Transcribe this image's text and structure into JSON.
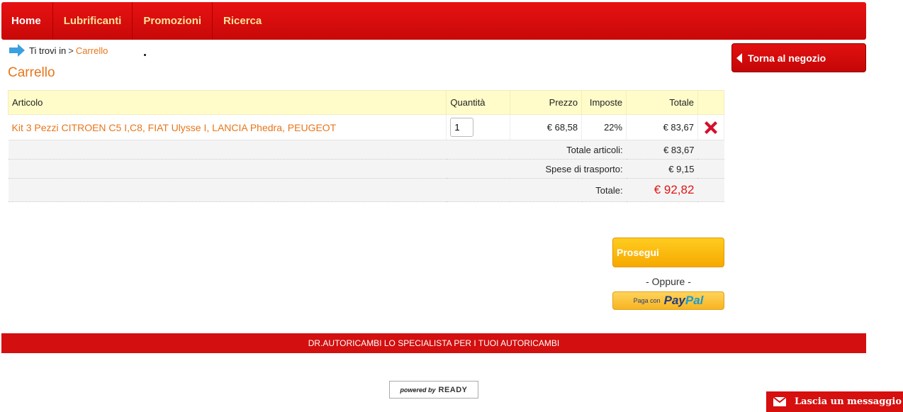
{
  "nav": {
    "items": [
      {
        "label": "Home"
      },
      {
        "label": "Lubrificanti"
      },
      {
        "label": "Promozioni"
      },
      {
        "label": "Ricerca"
      }
    ]
  },
  "breadcrumb": {
    "prefix": "Ti trovi in",
    "separator": ">",
    "current": "Carrello"
  },
  "page_title": "Carrello",
  "back_button": {
    "label": "Torna al negozio"
  },
  "cart": {
    "headers": {
      "articolo": "Articolo",
      "quantita": "Quantità",
      "prezzo": "Prezzo",
      "imposte": "Imposte",
      "totale": "Totale"
    },
    "items": [
      {
        "name": "Kit 3 Pezzi CITROEN C5 I,C8, FIAT Ulysse I, LANCIA Phedra, PEUGEOT",
        "quantity": "1",
        "price": "€ 68,58",
        "tax": "22%",
        "total": "€ 83,67"
      }
    ],
    "summary": {
      "items_label": "Totale articoli:",
      "items_value": "€ 83,67",
      "shipping_label": "Spese di trasporto:",
      "shipping_value": "€ 9,15",
      "grand_label": "Totale:",
      "grand_value": "€ 92,82"
    }
  },
  "actions": {
    "proceed_label": "Prosegui",
    "or_text": "- Oppure -",
    "paypal_prefix": "Paga con",
    "paypal_brand_a": "Pay",
    "paypal_brand_b": "Pal"
  },
  "footer": {
    "text": "DR.AUTORICAMBI LO SPECIALISTA PER I TUOI AUTORICAMBI",
    "powered_prefix": "powered by",
    "powered_brand": "READY"
  },
  "message_widget": {
    "label": "Lascia un messaggio"
  },
  "colors": {
    "brand_red": "#d30f0f",
    "accent_orange": "#e8761a",
    "button_yellow": "#ffc20e",
    "header_yellow": "#fffcc9"
  },
  "icons": [
    "arrow-right-icon",
    "chevron-left-icon",
    "delete-icon",
    "mail-icon"
  ]
}
